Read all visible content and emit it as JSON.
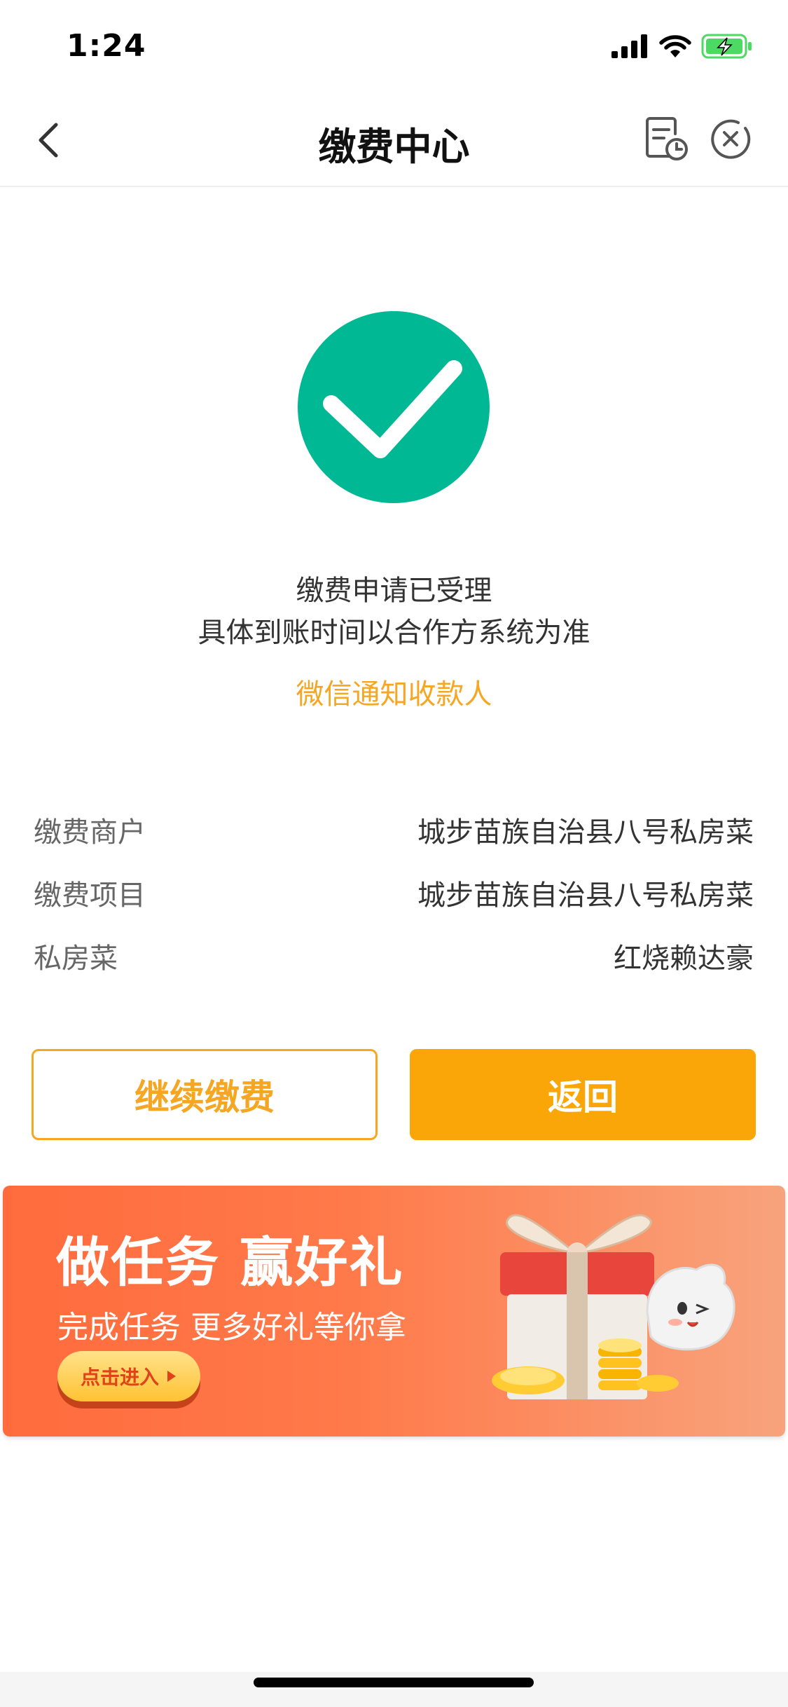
{
  "status_bar": {
    "time": "1:24"
  },
  "nav": {
    "title": "缴费中心"
  },
  "result": {
    "line1": "缴费申请已受理",
    "line2": "具体到账时间以合作方系统为准",
    "notify_link": "微信通知收款人"
  },
  "details": [
    {
      "label": "缴费商户",
      "value": "城步苗族自治县八号私房菜"
    },
    {
      "label": "缴费项目",
      "value": "城步苗族自治县八号私房菜"
    },
    {
      "label": "私房菜",
      "value": "红烧赖达豪"
    }
  ],
  "buttons": {
    "continue": "继续缴费",
    "return": "返回"
  },
  "banner": {
    "title": "做任务 赢好礼",
    "subtitle": "完成任务 更多好礼等你拿",
    "cta": "点击进入"
  },
  "colors": {
    "accent": "#f5a623",
    "success": "#00b893",
    "banner": "#ff6b3d"
  }
}
